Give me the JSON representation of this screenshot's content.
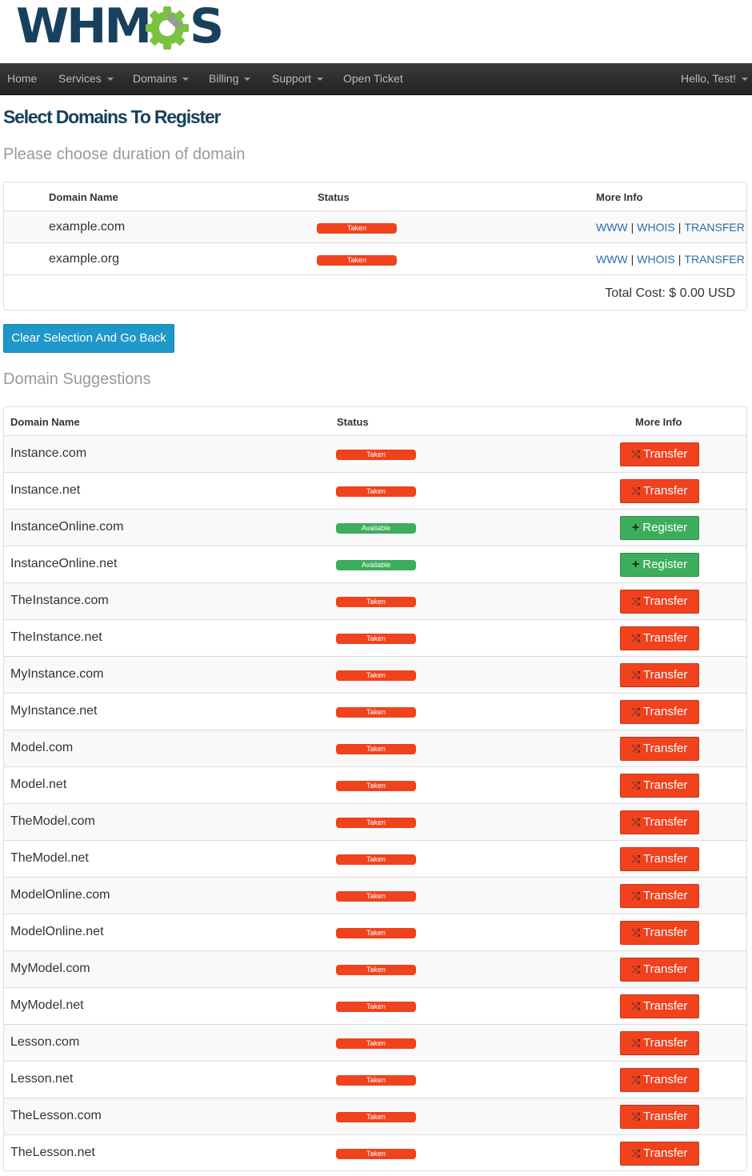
{
  "brand": {
    "logo_text": "WHM",
    "logo_tail": "S"
  },
  "nav": {
    "items": [
      {
        "label": "Home",
        "dropdown": false
      },
      {
        "label": "Services",
        "dropdown": true
      },
      {
        "label": "Domains",
        "dropdown": true
      },
      {
        "label": "Billing",
        "dropdown": true
      },
      {
        "label": "Support",
        "dropdown": true
      },
      {
        "label": "Open Ticket",
        "dropdown": false
      }
    ],
    "user_label": "Hello, Test!"
  },
  "page": {
    "title": "Select Domains To Register",
    "subtitle": "Please choose duration of domain"
  },
  "selected": {
    "headers": {
      "domain": "Domain Name",
      "status": "Status",
      "more": "More Info"
    },
    "rows": [
      {
        "domain": "example.com",
        "status": "Taken"
      },
      {
        "domain": "example.org",
        "status": "Taken"
      }
    ],
    "link_www": "WWW",
    "link_whois": "WHOIS",
    "link_transfer": "TRANSFER",
    "link_sep": "|",
    "total": "Total Cost: $ 0.00 USD"
  },
  "clear_button": "Clear Selection And Go Back",
  "suggestions": {
    "title": "Domain Suggestions",
    "headers": {
      "domain": "Domain Name",
      "status": "Status",
      "more": "More Info"
    },
    "rows": [
      {
        "domain": "Instance.com",
        "status": "Taken",
        "action": "Transfer"
      },
      {
        "domain": "Instance.net",
        "status": "Taken",
        "action": "Transfer"
      },
      {
        "domain": "InstanceOnline.com",
        "status": "Available",
        "action": "Register"
      },
      {
        "domain": "InstanceOnline.net",
        "status": "Available",
        "action": "Register"
      },
      {
        "domain": "TheInstance.com",
        "status": "Taken",
        "action": "Transfer"
      },
      {
        "domain": "TheInstance.net",
        "status": "Taken",
        "action": "Transfer"
      },
      {
        "domain": "MyInstance.com",
        "status": "Taken",
        "action": "Transfer"
      },
      {
        "domain": "MyInstance.net",
        "status": "Taken",
        "action": "Transfer"
      },
      {
        "domain": "Model.com",
        "status": "Taken",
        "action": "Transfer"
      },
      {
        "domain": "Model.net",
        "status": "Taken",
        "action": "Transfer"
      },
      {
        "domain": "TheModel.com",
        "status": "Taken",
        "action": "Transfer"
      },
      {
        "domain": "TheModel.net",
        "status": "Taken",
        "action": "Transfer"
      },
      {
        "domain": "ModelOnline.com",
        "status": "Taken",
        "action": "Transfer"
      },
      {
        "domain": "ModelOnline.net",
        "status": "Taken",
        "action": "Transfer"
      },
      {
        "domain": "MyModel.com",
        "status": "Taken",
        "action": "Transfer"
      },
      {
        "domain": "MyModel.net",
        "status": "Taken",
        "action": "Transfer"
      },
      {
        "domain": "Lesson.com",
        "status": "Taken",
        "action": "Transfer"
      },
      {
        "domain": "Lesson.net",
        "status": "Taken",
        "action": "Transfer"
      },
      {
        "domain": "TheLesson.com",
        "status": "Taken",
        "action": "Transfer"
      },
      {
        "domain": "TheLesson.net",
        "status": "Taken",
        "action": "Transfer"
      }
    ]
  },
  "icons": {
    "transfer": "shuffle-icon",
    "register": "plus-icon",
    "dropdown": "caret-down-icon"
  },
  "colors": {
    "brand": "#17415c",
    "gear": "#7cc242",
    "taken": "#f0421c",
    "available": "#3cad5c",
    "primary_button": "#1e97c9",
    "navbar": "#2b2b2b",
    "link": "#2b6dab"
  }
}
